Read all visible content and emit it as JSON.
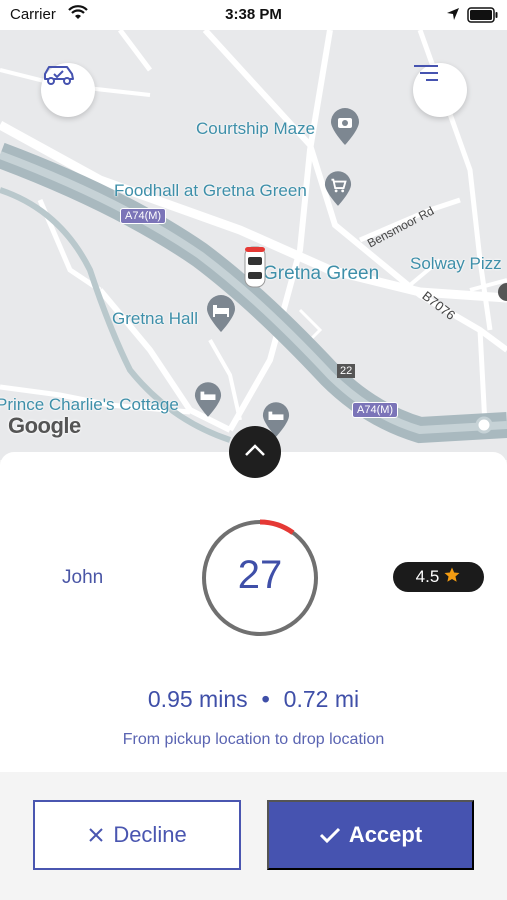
{
  "status_bar": {
    "carrier": "Carrier",
    "time": "3:38 PM"
  },
  "map": {
    "labels": {
      "courtship_maze": "Courtship Maze",
      "foodhall": "Foodhall at Gretna Green",
      "gretna_green": "Gretna Green",
      "solway_pizza": "Solway Pizz",
      "gretna_hall": "Gretna Hall",
      "prince_charlies": "Prince Charlie's Cottage",
      "bensmoor_rd": "Bensmoor Rd",
      "b7076": "B7076",
      "a74m_top": "A74(M)",
      "a74m_bottom": "A74(M)",
      "junction": "22"
    },
    "attribution": "Google"
  },
  "icons": {
    "car_check": "car-check-icon",
    "menu": "menu-lines-icon",
    "collapse": "chevron-up-icon",
    "star": "star-icon",
    "decline": "close-icon",
    "accept": "check-icon"
  },
  "ride": {
    "driver_name": "John",
    "countdown": "27",
    "countdown_progress": 0.1,
    "rating": "4.5",
    "duration": "0.95 mins",
    "separator": "•",
    "distance": "0.72 mi",
    "description": "From pickup location to drop location"
  },
  "actions": {
    "decline_label": "Decline",
    "accept_label": "Accept"
  },
  "colors": {
    "primary": "#4653b0",
    "timer_arc": "#e53935",
    "star": "#f39c12"
  }
}
